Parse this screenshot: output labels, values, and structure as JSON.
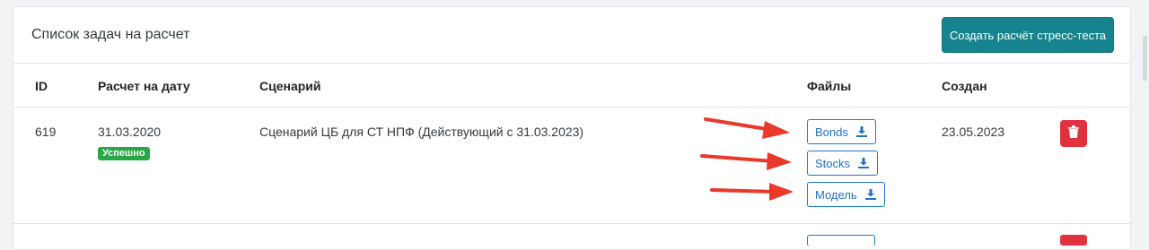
{
  "card": {
    "title": "Список задач на расчет",
    "create_button": "Создать расчёт стресс-теста"
  },
  "table": {
    "headers": {
      "id": "ID",
      "date": "Расчет на дату",
      "scenario": "Сценарий",
      "files": "Файлы",
      "created": "Создан"
    },
    "rows": [
      {
        "id": "619",
        "date": "31.03.2020",
        "status": "Успешно",
        "scenario": "Сценарий ЦБ для СТ НПФ (Действующий с 31.03.2023)",
        "files": [
          "Bonds",
          "Stocks",
          "Модель"
        ],
        "created": "23.05.2023"
      }
    ]
  },
  "colors": {
    "accent": "#16848f",
    "success": "#28a745",
    "danger": "#e0313f",
    "link": "#1f6fc5",
    "annotation_arrow": "#e8392b"
  },
  "icons": {
    "download": "download-icon",
    "delete": "trash-icon"
  }
}
